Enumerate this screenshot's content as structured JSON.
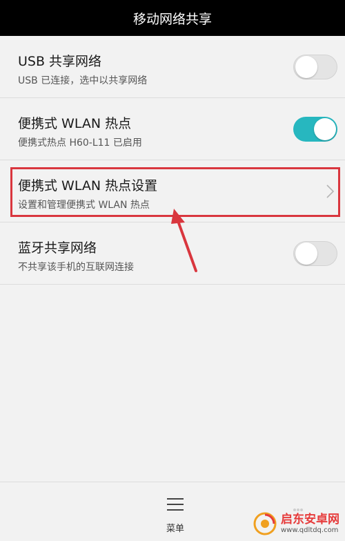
{
  "header": {
    "title": "移动网络共享"
  },
  "rows": [
    {
      "title": "USB 共享网络",
      "subtitle": "USB 已连接，选中以共享网络",
      "control": "toggle",
      "checked": false
    },
    {
      "title": "便携式 WLAN 热点",
      "subtitle": "便携式热点 H60-L11 已启用",
      "control": "toggle",
      "checked": true
    },
    {
      "title": "便携式 WLAN 热点设置",
      "subtitle": "设置和管理便携式 WLAN 热点",
      "control": "chevron"
    },
    {
      "title": "蓝牙共享网络",
      "subtitle": "不共享该手机的互联网连接",
      "control": "toggle",
      "checked": false
    }
  ],
  "bottom_bar": {
    "menu_label": "菜单"
  },
  "annotation": {
    "highlight_color": "#d9363e"
  },
  "colors": {
    "toggle_on": "#27b7bf",
    "header_bg": "#000000"
  },
  "watermark": {
    "title": "启东安卓网",
    "url": "www.qdltdq.com"
  }
}
